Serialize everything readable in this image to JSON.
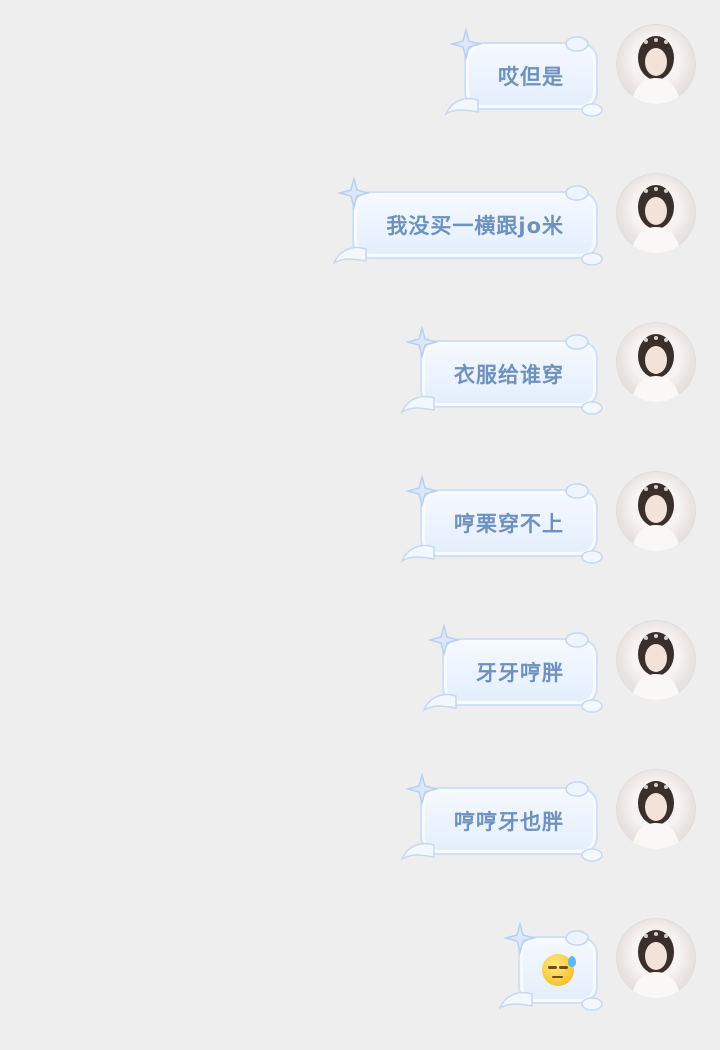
{
  "messages": [
    {
      "text": "哎但是"
    },
    {
      "text": "我没买一横跟jo米"
    },
    {
      "text": "衣服给谁穿"
    },
    {
      "text": "哼栗穿不上"
    },
    {
      "text": "牙牙哼胖"
    },
    {
      "text": "哼哼牙也胖"
    },
    {
      "text": "",
      "emoji": "sweat-smile-emoji"
    }
  ],
  "colors": {
    "background": "#eeeeee",
    "bubble_text": "#6f91bd",
    "bubble_fill": "#e3eefc",
    "bubble_border": "#cfe0f7"
  }
}
